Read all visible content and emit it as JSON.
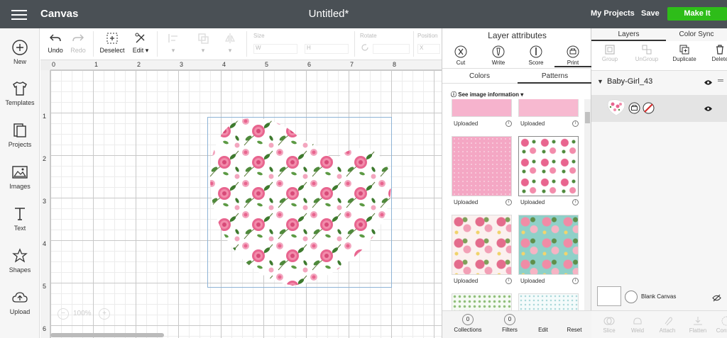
{
  "topbar": {
    "app_title": "Canvas",
    "doc_title": "Untitled*",
    "my_projects": "My Projects",
    "save": "Save",
    "make_it": "Make It",
    "accent_color": "#2ebd19"
  },
  "sidebar": {
    "items": [
      {
        "label": "New",
        "icon": "plus-circle-icon"
      },
      {
        "label": "Templates",
        "icon": "shirt-icon"
      },
      {
        "label": "Projects",
        "icon": "projects-icon"
      },
      {
        "label": "Images",
        "icon": "image-icon"
      },
      {
        "label": "Text",
        "icon": "text-icon"
      },
      {
        "label": "Shapes",
        "icon": "shapes-icon"
      },
      {
        "label": "Upload",
        "icon": "cloud-upload-icon"
      }
    ]
  },
  "toolbar": {
    "undo": "Undo",
    "redo": "Redo",
    "deselect": "Deselect",
    "edit": "Edit",
    "size": "Size",
    "w": "W",
    "h": "H",
    "rotate": "Rotate",
    "position": "Position",
    "x": "X"
  },
  "canvas": {
    "ruler_top": [
      "0",
      "1",
      "2",
      "3",
      "4",
      "5",
      "6",
      "7",
      "8"
    ],
    "ruler_left": [
      "1",
      "2",
      "3",
      "4",
      "5",
      "6"
    ],
    "zoom": "100%"
  },
  "layer_attributes": {
    "title": "Layer attributes",
    "ops": [
      "Cut",
      "Write",
      "Score",
      "Print"
    ],
    "tabs": [
      "Colors",
      "Patterns"
    ],
    "see_info": "See image information",
    "uploaded_label": "Uploaded",
    "footer": {
      "collections_count": "0",
      "collections": "Collections",
      "filters_count": "0",
      "filters": "Filters",
      "edit": "Edit",
      "reset": "Reset"
    }
  },
  "layers": {
    "tabs": [
      "Layers",
      "Color Sync"
    ],
    "tools": [
      "Group",
      "UnGroup",
      "Duplicate",
      "Delete"
    ],
    "group_name": "Baby-Girl_43",
    "blank_canvas": "Blank Canvas",
    "bottom_tools": [
      "Slice",
      "Weld",
      "Attach",
      "Flatten",
      "Contour"
    ]
  }
}
